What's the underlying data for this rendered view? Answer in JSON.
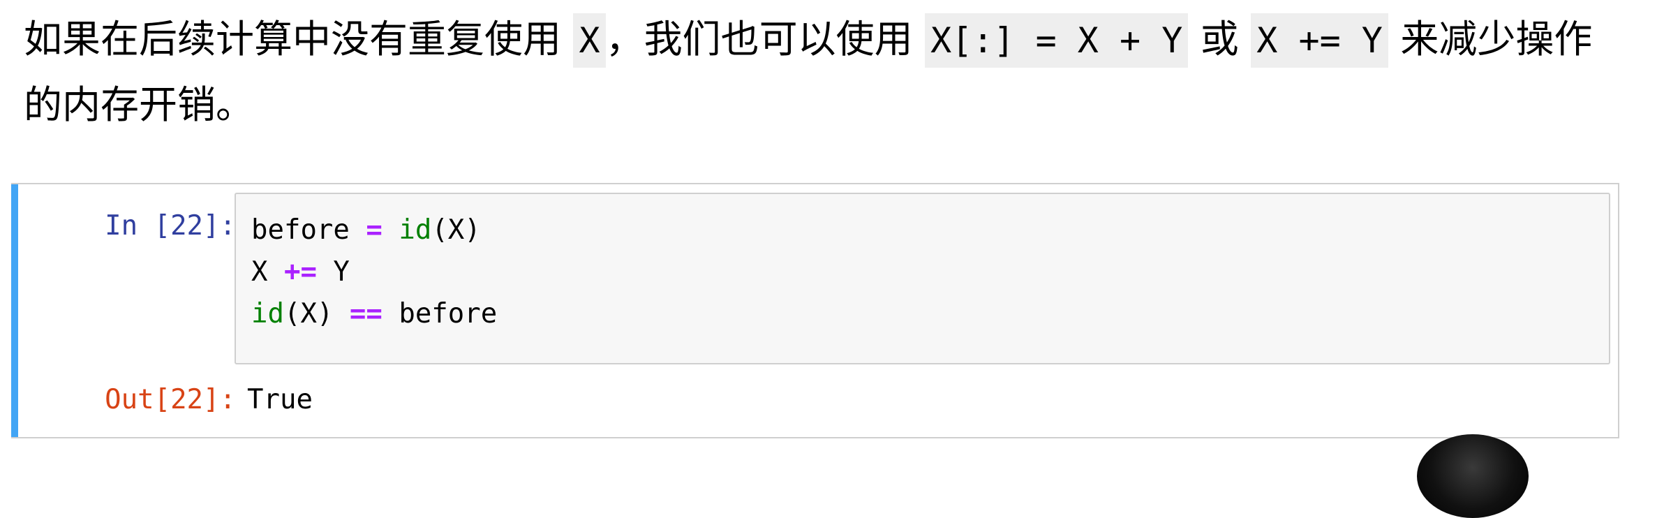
{
  "prose": {
    "t1": "如果在后续计算中没有重复使用 ",
    "c1": "X",
    "t2": "，我们也可以使用 ",
    "c2": "X[:] = X + Y",
    "t3": " 或 ",
    "c3": "X += Y",
    "t4": " 来减少操作的内存开销。"
  },
  "cell": {
    "in_prompt": "In [22]:",
    "out_prompt": "Out[22]:",
    "output": "True",
    "code": {
      "l1_a": "before ",
      "l1_op": "=",
      "l1_sp": " ",
      "l1_fn": "id",
      "l1_b": "(X)",
      "l2_a": "X ",
      "l2_op": "+=",
      "l2_b": " Y",
      "l3_fn": "id",
      "l3_a": "(X) ",
      "l3_op": "==",
      "l3_b": " before"
    }
  },
  "colors": {
    "cell_bar": "#42a5f5",
    "in_prompt": "#303f9f",
    "out_prompt": "#d84315",
    "keyword_op": "#aa22ff",
    "builtin": "#008000"
  },
  "icons": {
    "avatar": "presenter-avatar-icon"
  }
}
